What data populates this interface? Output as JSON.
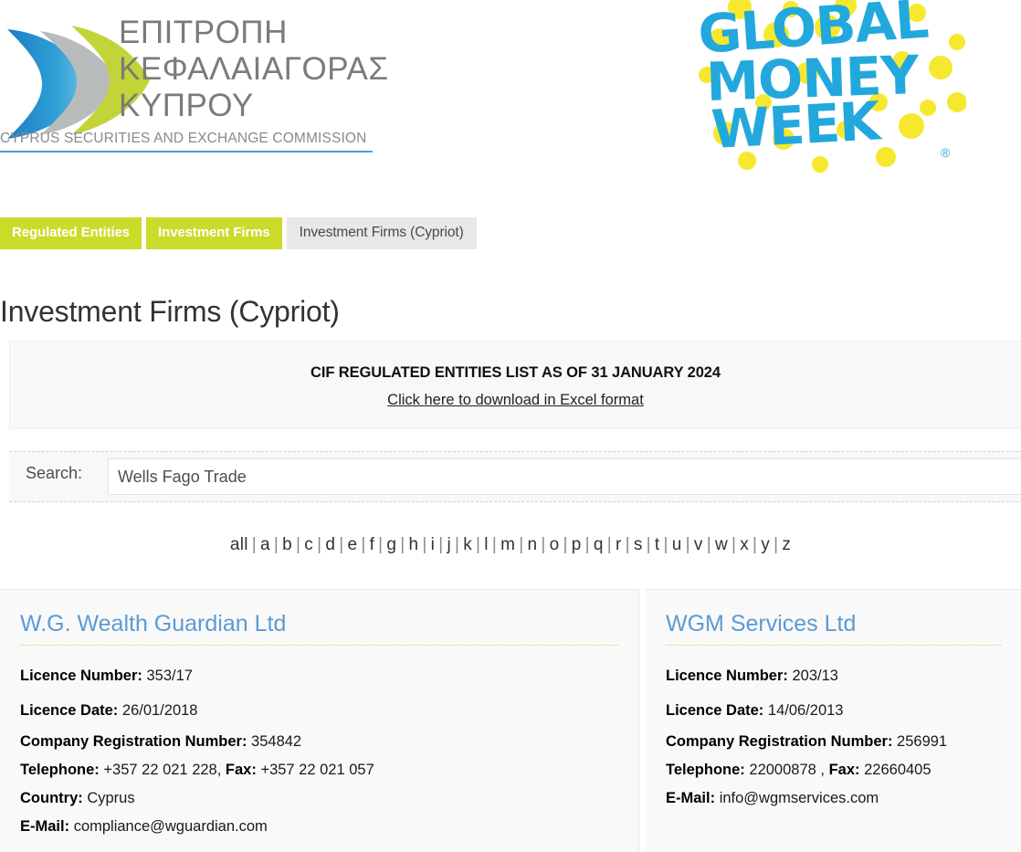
{
  "header": {
    "logo_left": {
      "name": "cysec-logo",
      "greek_lines": "ΕΠΙΤΡΟΠΗ\nΚΕΦΑΛΑΙΑΓΟΡΑΣ\nΚΥΠΡΟΥ",
      "english": "CYPRUS SECURITIES AND EXCHANGE COMMISSION",
      "accent_color": "#4e9ed4",
      "green_color": "#cbdb2a",
      "grey_color": "#b4b4b4"
    },
    "logo_right": {
      "name": "global-money-week-logo",
      "line1": "GLOBAL",
      "line2": "MONEY",
      "line3": "WEEK",
      "registered_mark": "®",
      "blue": "#2aabe2",
      "yellow": "#f7e733"
    }
  },
  "breadcrumb": {
    "tabs": [
      {
        "label": "Regulated Entities",
        "state": "link"
      },
      {
        "label": "Investment Firms",
        "state": "link"
      },
      {
        "label": "Investment Firms (Cypriot)",
        "state": "current"
      }
    ]
  },
  "page": {
    "title": "Investment Firms (Cypriot)"
  },
  "info_panel": {
    "title": "CIF REGULATED ENTITIES LIST AS OF 31 JANUARY 2024",
    "download_link": "Click here to download in Excel format"
  },
  "search": {
    "label": "Search:",
    "value": "Wells Fago Trade",
    "placeholder": ""
  },
  "alphabet": {
    "all_label": "all",
    "separator": "|",
    "letters": [
      "a",
      "b",
      "c",
      "d",
      "e",
      "f",
      "g",
      "h",
      "i",
      "j",
      "k",
      "l",
      "m",
      "n",
      "o",
      "p",
      "q",
      "r",
      "s",
      "t",
      "u",
      "v",
      "w",
      "x",
      "y",
      "z"
    ]
  },
  "results": [
    {
      "title": "W.G. Wealth Guardian Ltd",
      "fields": [
        {
          "label": "Licence Number",
          "sep": ":",
          "value": "353/17"
        },
        {
          "label": "Licence Date:",
          "sep": "",
          "value": "26/01/2018"
        },
        {
          "label": "Company Registration Number",
          "sep": ":",
          "value": "354842"
        },
        {
          "label": "Telephone",
          "sep": ":",
          "value": "+357 22 021 228,",
          "label2": "Fax",
          "sep2": ":",
          "value2": "+357 22 021 057"
        },
        {
          "label": "Country",
          "sep": ":",
          "value": "Cyprus"
        },
        {
          "label": "E-Mail",
          "sep": ":",
          "value": "compliance@wguardian.com"
        }
      ]
    },
    {
      "title": "WGM Services Ltd",
      "fields": [
        {
          "label": "Licence Number",
          "sep": ":",
          "value": "203/13"
        },
        {
          "label": "Licence Date:",
          "sep": "",
          "value": "14/06/2013"
        },
        {
          "label": "Company Registration Number",
          "sep": ":",
          "value": "256991"
        },
        {
          "label": "Telephone",
          "sep": ":",
          "value": "22000878 ,",
          "label2": "Fax",
          "sep2": ":",
          "value2": "22660405"
        },
        {
          "label": "E-Mail",
          "sep": ":",
          "value": "info@wgmservices.com"
        }
      ]
    }
  ]
}
